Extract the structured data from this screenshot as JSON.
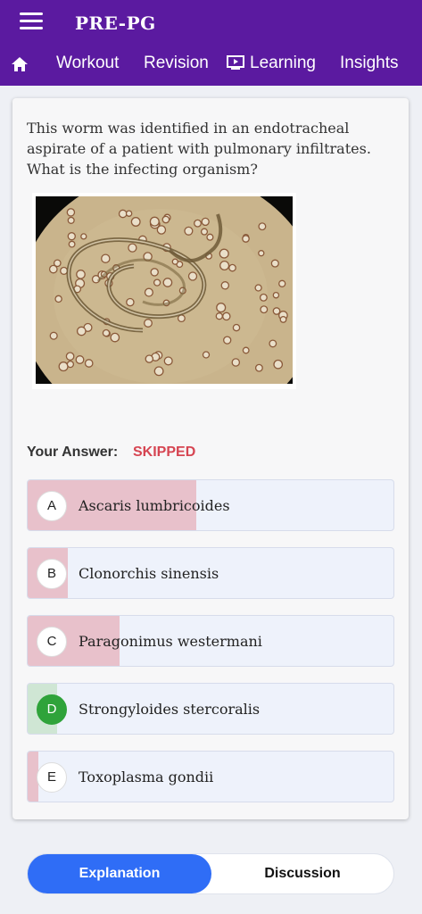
{
  "app": {
    "title": "PRE-PG",
    "nav": {
      "workout": "Workout",
      "revision": "Revision",
      "learning": "Learning",
      "insights": "Insights"
    }
  },
  "question": {
    "text": "This worm was identified in an endotracheal aspirate of a patient with pulmonary infiltrates. What is the infecting organism?",
    "your_answer_label": "Your Answer:",
    "your_answer_value": "SKIPPED",
    "options": [
      {
        "letter": "A",
        "text": "Ascaris lumbricoides",
        "response_share": 0.46,
        "correct": false
      },
      {
        "letter": "B",
        "text": "Clonorchis sinensis",
        "response_share": 0.11,
        "correct": false
      },
      {
        "letter": "C",
        "text": "Paragonimus westermani",
        "response_share": 0.25,
        "correct": false
      },
      {
        "letter": "D",
        "text": "Strongyloides stercoralis",
        "response_share": 0.08,
        "correct": true
      },
      {
        "letter": "E",
        "text": "Toxoplasma gondii",
        "response_share": 0.03,
        "correct": false
      }
    ]
  },
  "tabs": {
    "explanation": "Explanation",
    "discussion": "Discussion"
  },
  "colors": {
    "header": "#5b1aa0",
    "wrong_fill": "#e8c1cb",
    "correct_fill": "#cfe6d4",
    "accent": "#2f6df6",
    "skipped": "#d64552"
  }
}
